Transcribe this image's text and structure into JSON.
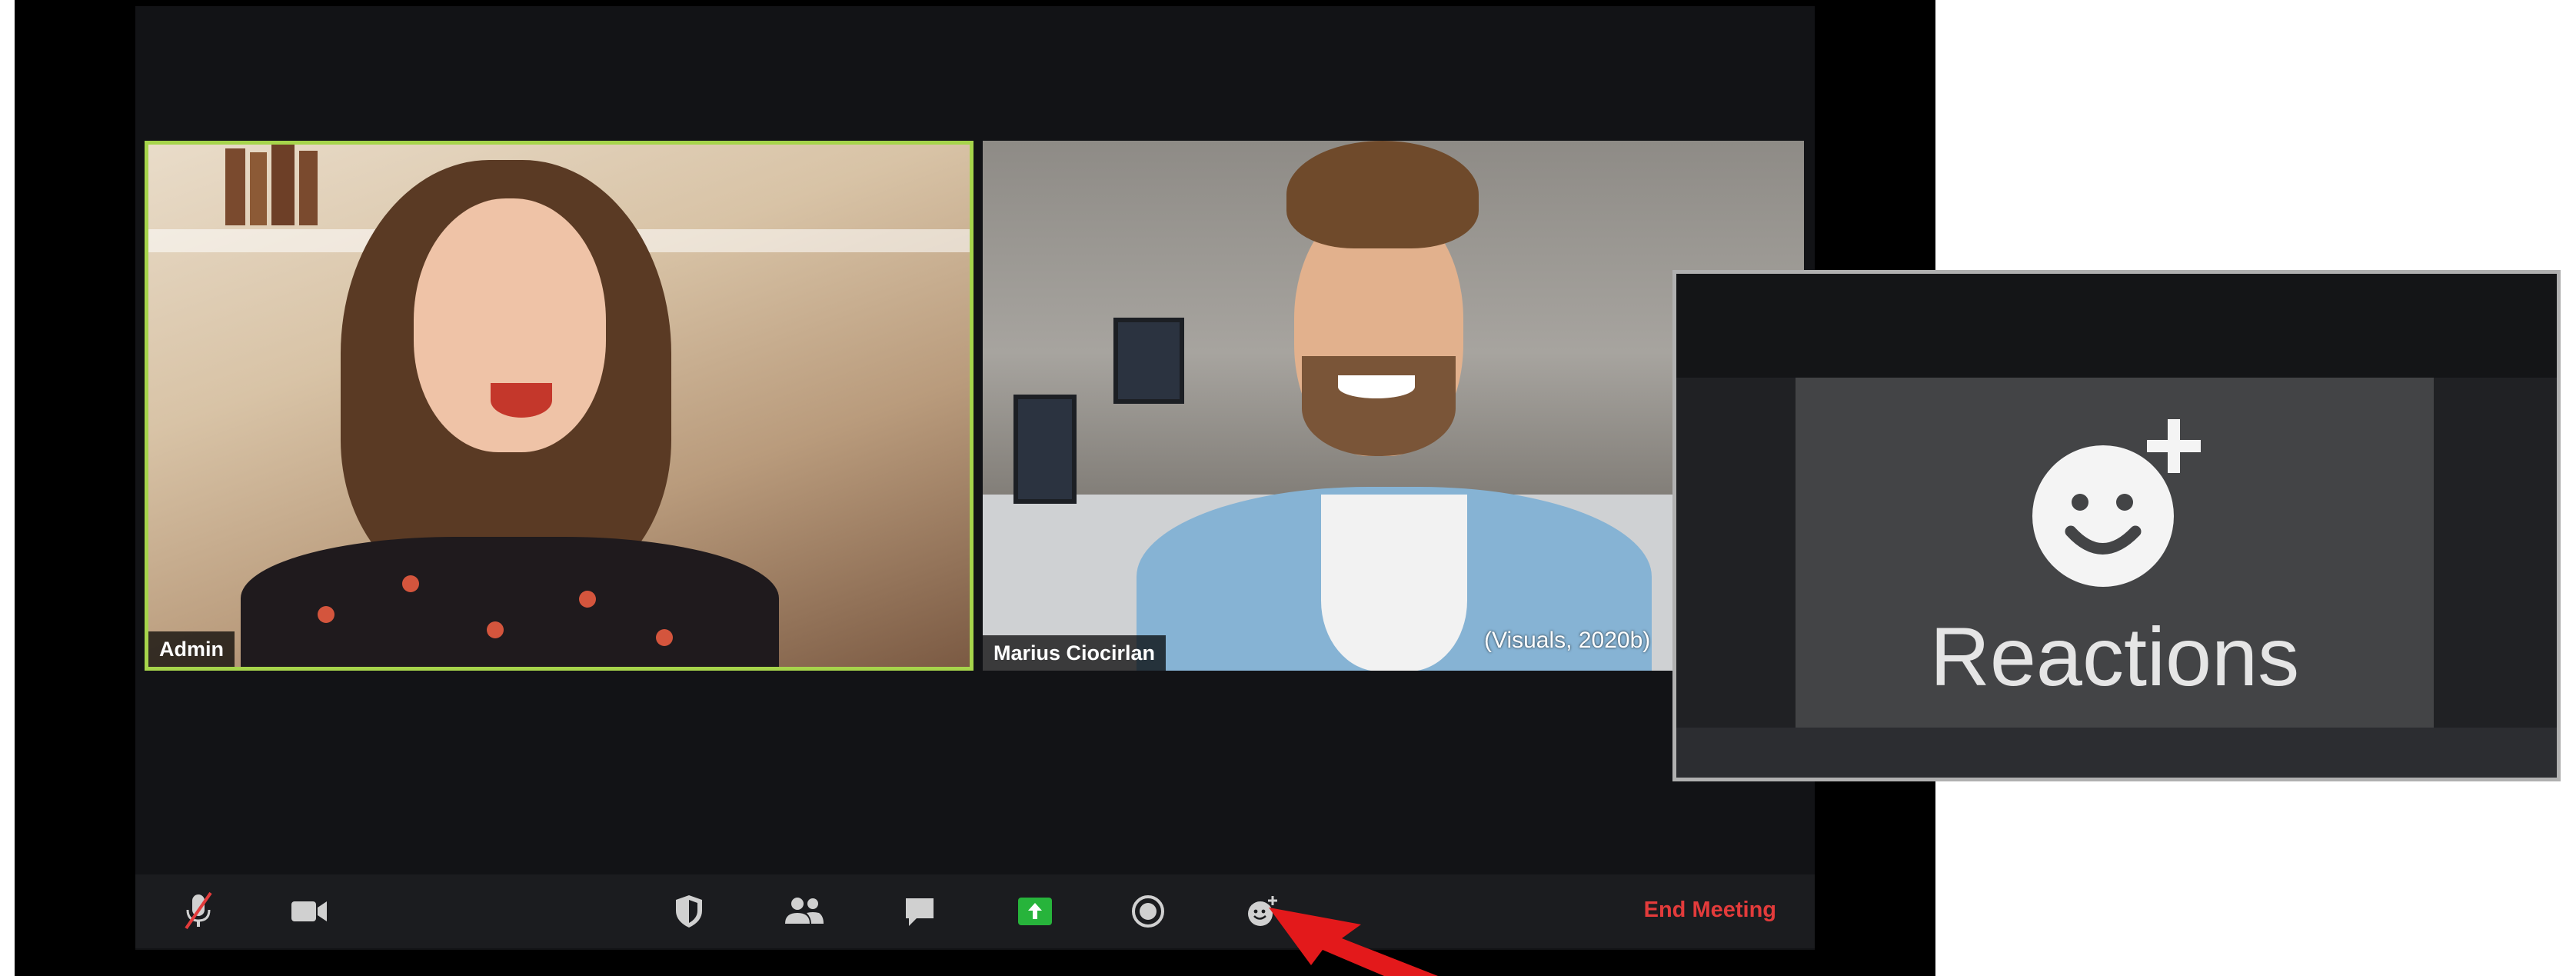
{
  "meeting": {
    "participants": [
      {
        "name": "Admin",
        "active_speaker": true
      },
      {
        "name": "Marius Ciocirlan",
        "active_speaker": false
      }
    ],
    "image_credit": "(Visuals, 2020b)"
  },
  "toolbar": {
    "buttons": [
      {
        "icon": "microphone-muted-icon"
      },
      {
        "icon": "video-camera-icon"
      },
      {
        "icon": "shield-security-icon"
      },
      {
        "icon": "participants-icon"
      },
      {
        "icon": "chat-bubble-icon"
      },
      {
        "icon": "share-screen-icon"
      },
      {
        "icon": "record-icon"
      },
      {
        "icon": "reactions-icon"
      }
    ],
    "end_meeting_label": "End Meeting"
  },
  "callout": {
    "label": "Reactions",
    "icon": "reactions-smiley-plus-icon"
  },
  "colors": {
    "active_speaker_border": "#a6d44b",
    "share_button": "#27b43b",
    "end_meeting": "#e33b3b",
    "pointer_arrow": "#e3191b"
  }
}
